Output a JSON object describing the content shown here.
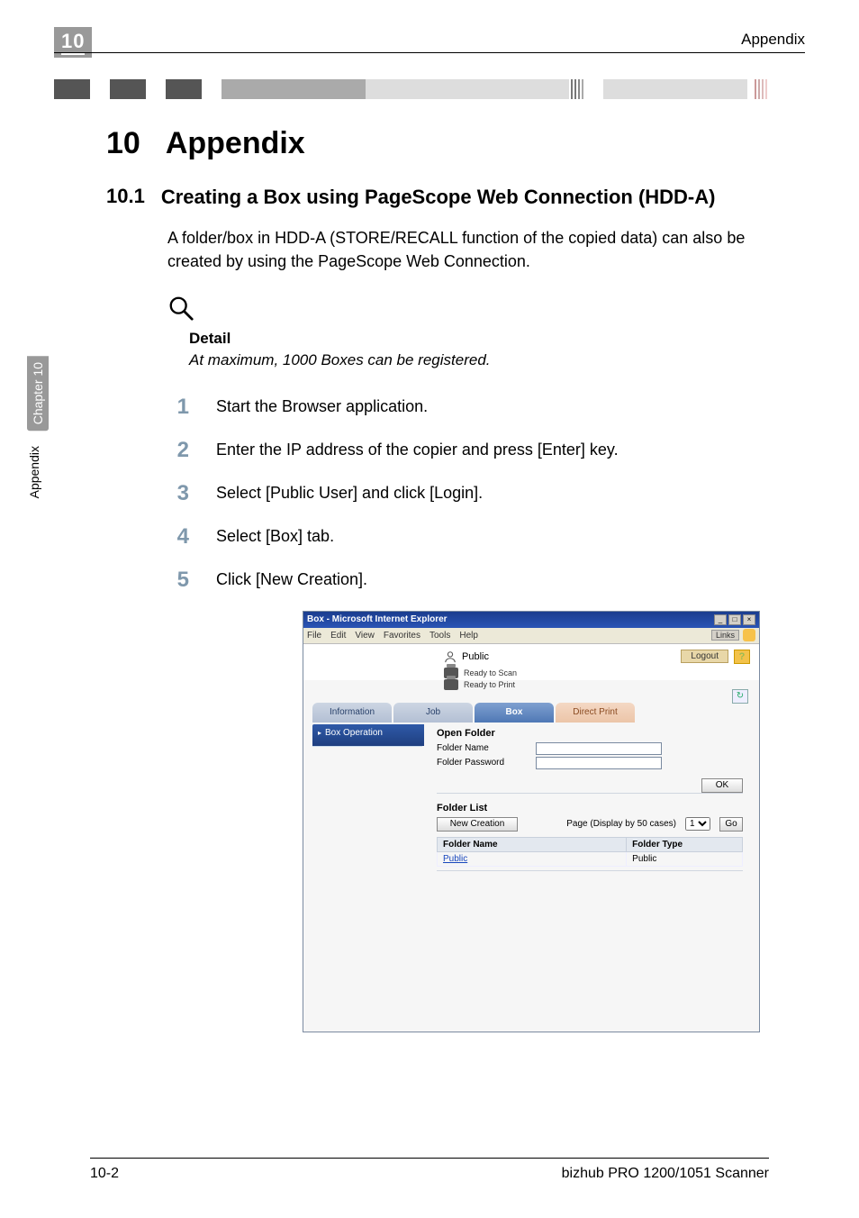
{
  "header": {
    "chapter_number": "10",
    "header_right": "Appendix"
  },
  "sidebar": {
    "chapter_label": "Chapter 10",
    "section_label": "Appendix"
  },
  "title": {
    "number": "10",
    "text": "Appendix"
  },
  "section": {
    "number": "10.1",
    "text": "Creating a Box using PageScope Web Connection (HDD-A)"
  },
  "intro_paragraph": "A folder/box in HDD-A (STORE/RECALL function of the copied data) can also be created by using the PageScope Web Connection.",
  "detail": {
    "label": "Detail",
    "text": "At maximum, 1000 Boxes can be registered."
  },
  "steps": [
    {
      "num": "1",
      "text": "Start the Browser application."
    },
    {
      "num": "2",
      "text": "Enter the IP address of the copier and press [Enter] key."
    },
    {
      "num": "3",
      "text": "Select [Public User] and click [Login]."
    },
    {
      "num": "4",
      "text": "Select [Box] tab."
    },
    {
      "num": "5",
      "text": "Click [New Creation]."
    }
  ],
  "screenshot": {
    "window_title": "Box - Microsoft Internet Explorer",
    "menu": {
      "file": "File",
      "edit": "Edit",
      "view": "View",
      "fav": "Favorites",
      "tools": "Tools",
      "help": "Help",
      "links": "Links"
    },
    "user_name": "Public",
    "logout_label": "Logout",
    "help_label": "?",
    "status_scan": "Ready to Scan",
    "status_print": "Ready to Print",
    "refresh_symbol": "↻",
    "tabs": {
      "information": "Information",
      "job": "Job",
      "box": "Box",
      "direct_print": "Direct Print"
    },
    "side_item": "Box Operation",
    "open_folder": {
      "heading": "Open Folder",
      "name_label": "Folder Name",
      "pass_label": "Folder Password",
      "ok_label": "OK"
    },
    "folder_list": {
      "heading": "Folder List",
      "new_creation_label": "New Creation",
      "page_label": "Page (Display by 50 cases)",
      "page_value": "1",
      "go_label": "Go",
      "col_name": "Folder Name",
      "col_type": "Folder Type",
      "row_name": "Public",
      "row_type": "Public"
    }
  },
  "footer": {
    "page": "10-2",
    "model": "bizhub PRO 1200/1051 Scanner"
  }
}
